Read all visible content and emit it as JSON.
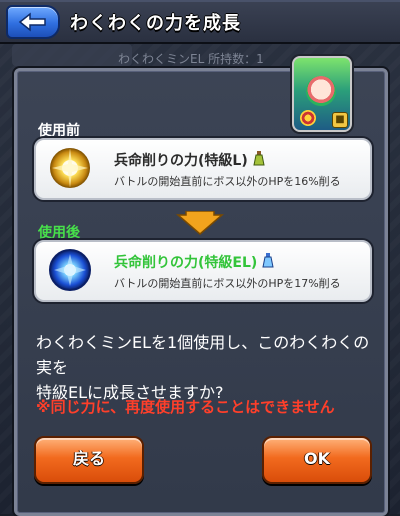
{
  "header": {
    "title": "わくわくの力を成長"
  },
  "background": {
    "info_text": "わくわくミンEL 所持数：1"
  },
  "dialog": {
    "before_label": "使用前",
    "after_label": "使用後",
    "before_item": {
      "title": "兵命削りの力(特級L)",
      "description": "バトルの開始直前にボス以外のHPを16%削る"
    },
    "after_item": {
      "title": "兵命削りの力(特級EL)",
      "description": "バトルの開始直前にボス以外のHPを17%削る"
    },
    "prompt_line1": "わくわくミンELを1個使用し、このわくわくの実を",
    "prompt_line2": "特級ELに成長させますか?",
    "warning": "※同じ力に、再度使用することはできません",
    "back_label": "戻る",
    "ok_label": "OK"
  },
  "colors": {
    "before_label": "#ffffff",
    "after_label": "#47e04a",
    "after_title": "#33c43a",
    "warning": "#ff3f2a",
    "button": "#f26a1e"
  },
  "icons": [
    "back-arrow-icon",
    "golden-fruit-icon",
    "blue-fruit-icon",
    "bottle-icon",
    "down-arrow-icon",
    "lock-icon"
  ]
}
